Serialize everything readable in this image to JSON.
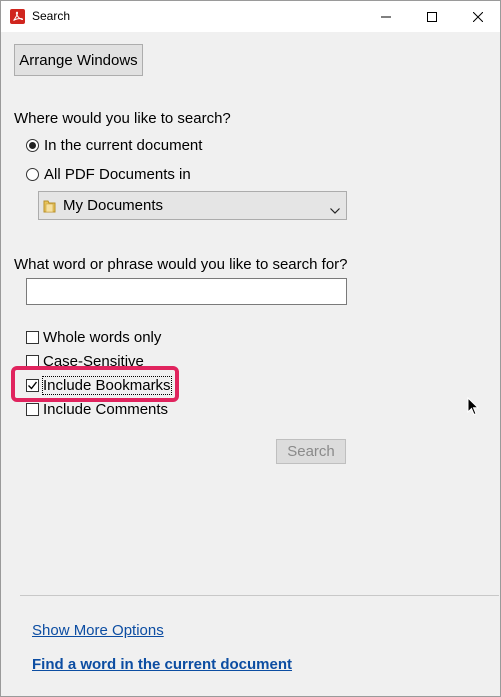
{
  "window": {
    "title": "Search"
  },
  "toolbar": {
    "arrange_label": "Arrange Windows"
  },
  "where": {
    "question": "Where would you like to search?",
    "options": [
      {
        "label": "In the current document",
        "selected": true
      },
      {
        "label": "All PDF Documents in",
        "selected": false
      }
    ],
    "location_value": "My Documents"
  },
  "phrase": {
    "question": "What word or phrase would you like to search for?",
    "value": ""
  },
  "options": [
    {
      "label": "Whole words only",
      "checked": false
    },
    {
      "label": "Case-Sensitive",
      "checked": false
    },
    {
      "label": "Include Bookmarks",
      "checked": true
    },
    {
      "label": "Include Comments",
      "checked": false
    }
  ],
  "actions": {
    "search_label": "Search"
  },
  "links": {
    "more_options": "Show More Options",
    "find_word": "Find a word in the current document"
  },
  "colors": {
    "highlight": "#e0245e",
    "link": "#0c4da2",
    "app_icon": "#d0251e"
  }
}
